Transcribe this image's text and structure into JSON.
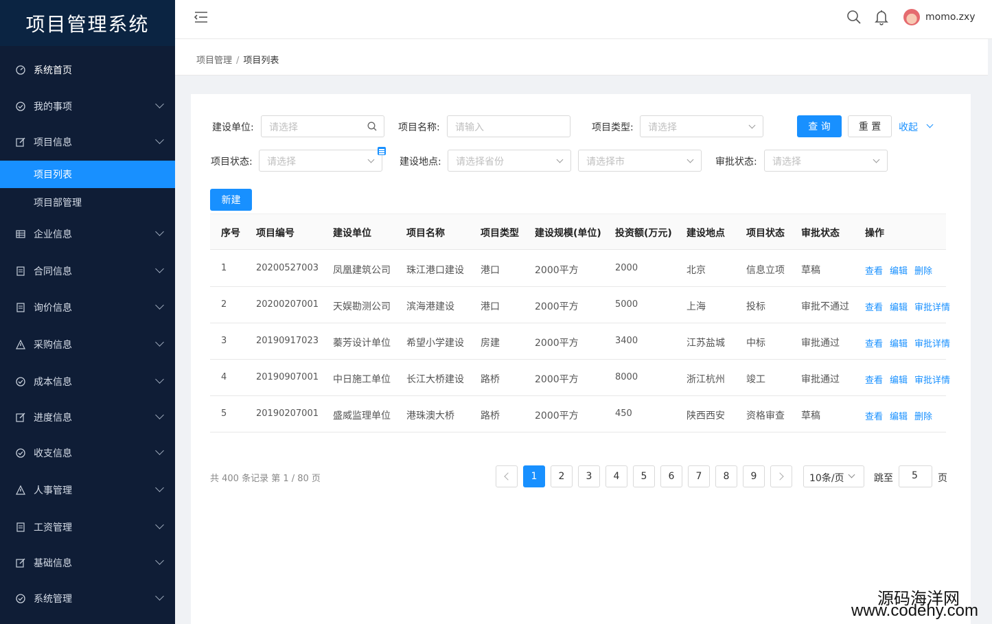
{
  "app": {
    "title": "项目管理系统"
  },
  "sidebar": {
    "items": [
      {
        "label": "系统首页",
        "icon": "dashboard-icon",
        "arrow": false
      },
      {
        "label": "我的事项",
        "icon": "check-circle-icon",
        "arrow": true
      },
      {
        "label": "项目信息",
        "icon": "edit-icon",
        "arrow": true
      },
      {
        "label": "项目列表",
        "icon": "",
        "arrow": false,
        "active": true
      },
      {
        "label": "项目部管理",
        "icon": "",
        "arrow": false
      },
      {
        "label": "企业信息",
        "icon": "table-icon",
        "arrow": true
      },
      {
        "label": "合同信息",
        "icon": "file-icon",
        "arrow": true
      },
      {
        "label": "询价信息",
        "icon": "file-icon",
        "arrow": true
      },
      {
        "label": "采购信息",
        "icon": "warning-icon",
        "arrow": true
      },
      {
        "label": "成本信息",
        "icon": "check-circle-icon",
        "arrow": true
      },
      {
        "label": "进度信息",
        "icon": "edit-icon",
        "arrow": true
      },
      {
        "label": "收支信息",
        "icon": "check-circle-icon",
        "arrow": true
      },
      {
        "label": "人事管理",
        "icon": "warning-icon",
        "arrow": true
      },
      {
        "label": "工资管理",
        "icon": "file-icon",
        "arrow": true
      },
      {
        "label": "基础信息",
        "icon": "edit-icon",
        "arrow": true
      },
      {
        "label": "系统管理",
        "icon": "check-circle-icon",
        "arrow": true
      }
    ]
  },
  "header": {
    "username": "momo.zxy"
  },
  "breadcrumb": {
    "parent": "项目管理",
    "sep": "/",
    "current": "项目列表"
  },
  "filters": {
    "build_unit_label": "建设单位:",
    "build_unit_placeholder": "请选择",
    "project_name_label": "项目名称:",
    "project_name_placeholder": "请输入",
    "project_type_label": "项目类型:",
    "project_type_placeholder": "请选择",
    "project_status_label": "项目状态:",
    "project_status_placeholder": "请选择",
    "location_label": "建设地点:",
    "province_placeholder": "请选择省份",
    "city_placeholder": "请选择市",
    "approval_label": "审批状态:",
    "approval_placeholder": "请选择",
    "query_button": "查 询",
    "reset_button": "重 置",
    "collapse_link": "收起"
  },
  "new_button": "新建",
  "table": {
    "columns": [
      "序号",
      "项目编号",
      "建设单位",
      "项目名称",
      "项目类型",
      "建设规模(单位)",
      "投资额(万元)",
      "建设地点",
      "项目状态",
      "审批状态",
      "操作"
    ],
    "rows": [
      {
        "no": "1",
        "code": "20200527003",
        "unit": "凤凰建筑公司",
        "name": "珠江港口建设",
        "type": "港口",
        "scale": "2000平方",
        "invest": "2000",
        "location": "北京",
        "status": "信息立项",
        "approval": "草稿",
        "ops": [
          "查看",
          "编辑",
          "删除"
        ]
      },
      {
        "no": "2",
        "code": "20200207001",
        "unit": "天娱勘测公司",
        "name": "滨海港建设",
        "type": "港口",
        "scale": "2000平方",
        "invest": "5000",
        "location": "上海",
        "status": "投标",
        "approval": "审批不通过",
        "ops": [
          "查看",
          "编辑",
          "审批详情"
        ]
      },
      {
        "no": "3",
        "code": "20190917023",
        "unit": "蓁芳设计单位",
        "name": "希望小学建设",
        "type": "房建",
        "scale": "2000平方",
        "invest": "3400",
        "location": "江苏盐城",
        "status": "中标",
        "approval": "审批通过",
        "ops": [
          "查看",
          "编辑",
          "审批详情"
        ]
      },
      {
        "no": "4",
        "code": "20190907001",
        "unit": "中日施工单位",
        "name": "长江大桥建设",
        "type": "路桥",
        "scale": "2000平方",
        "invest": "8000",
        "location": "浙江杭州",
        "status": "竣工",
        "approval": "审批通过",
        "ops": [
          "查看",
          "编辑",
          "审批详情"
        ]
      },
      {
        "no": "5",
        "code": "20190207001",
        "unit": "盛威监理单位",
        "name": "港珠澳大桥",
        "type": "路桥",
        "scale": "2000平方",
        "invest": "450",
        "location": "陕西西安",
        "status": "资格审查",
        "approval": "草稿",
        "ops": [
          "查看",
          "编辑",
          "删除"
        ]
      }
    ]
  },
  "pagination": {
    "summary": "共 400 条记录 第 1 / 80 页",
    "pages": [
      "1",
      "2",
      "3",
      "4",
      "5",
      "6",
      "7",
      "8",
      "9"
    ],
    "current": "1",
    "page_size": "10条/页",
    "jump_label": "跳至",
    "jump_value": "5",
    "page_suffix": "页"
  },
  "watermark": {
    "line1": "源码海洋网",
    "line2": "www.codehy.com"
  }
}
